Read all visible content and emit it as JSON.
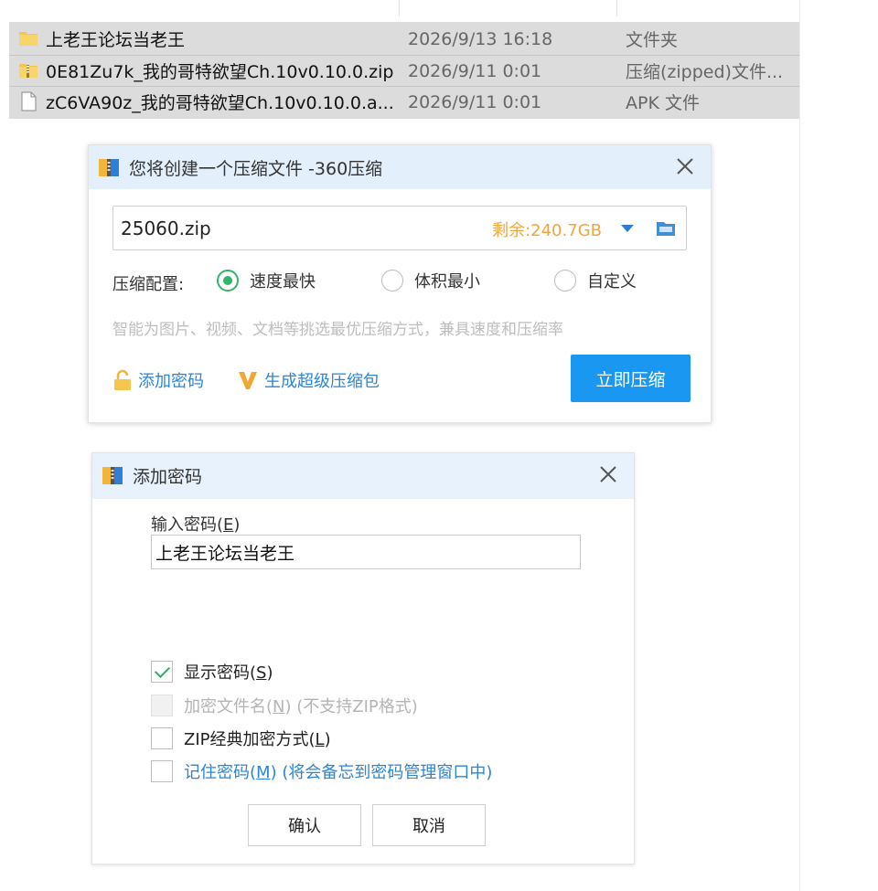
{
  "files": [
    {
      "icon": "folder-icon",
      "name": "上老王论坛当老王",
      "date": "2026/9/13 16:18",
      "type": "文件夹"
    },
    {
      "icon": "zip-file-icon",
      "name": "0E81Zu7k_我的哥特欲望Ch.10v0.10.0.zip",
      "date": "2026/9/11 0:01",
      "type": "压缩(zipped)文件..."
    },
    {
      "icon": "apk-file-icon",
      "name": "zC6VA90z_我的哥特欲望Ch.10v0.10.0.a...",
      "date": "2026/9/11 0:01",
      "type": "APK 文件"
    }
  ],
  "compress_dialog": {
    "title": "您将创建一个压缩文件 -360压缩",
    "filename": "25060.zip",
    "free_space": "剩余:240.7GB",
    "config_label": "压缩配置:",
    "options": [
      {
        "label": "速度最快",
        "selected": true
      },
      {
        "label": "体积最小",
        "selected": false
      },
      {
        "label": "自定义",
        "selected": false
      }
    ],
    "hint": "智能为图片、视频、文档等挑选最优压缩方式，兼具速度和压缩率",
    "add_password": "添加密码",
    "super_package": "生成超级压缩包",
    "compress_button": "立即压缩",
    "accent": "#1a97f0"
  },
  "password_dialog": {
    "title": "添加密码",
    "input_label_main": "输入密码(",
    "input_label_key": "E",
    "input_label_end": ")",
    "password_value": "上老王论坛当老王",
    "checkboxes": [
      {
        "main": "显示密码(",
        "key": "S",
        "end": ")",
        "suffix": "",
        "checked": true,
        "disabled": false
      },
      {
        "main": "加密文件名(",
        "key": "N",
        "end": ")",
        "suffix": " (不支持ZIP格式)",
        "checked": false,
        "disabled": true
      },
      {
        "main": "ZIP经典加密方式(",
        "key": "L",
        "end": ")",
        "suffix": "",
        "checked": false,
        "disabled": false
      },
      {
        "main": "记住密码(",
        "key": "M",
        "end": ")",
        "suffix": " (将会备忘到密码管理窗口中)",
        "checked": false,
        "disabled": false
      }
    ],
    "ok_button": "确认",
    "cancel_button": "取消"
  }
}
